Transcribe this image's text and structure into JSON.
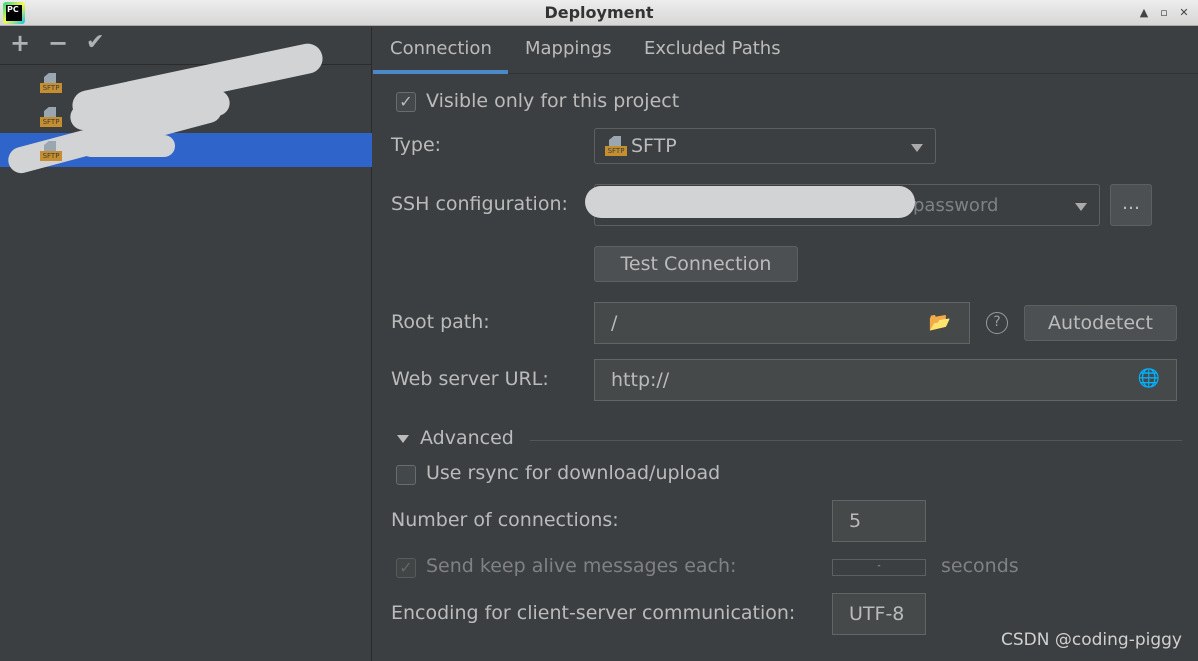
{
  "window": {
    "title": "Deployment",
    "logo_text": "PC"
  },
  "sidebar": {
    "add": "+",
    "remove": "−",
    "apply": "✔",
    "items": [
      {
        "badge": "SFTP",
        "selected": false
      },
      {
        "badge": "SFTP",
        "selected": false
      },
      {
        "badge": "SFTP",
        "selected": true
      }
    ]
  },
  "tabs": [
    {
      "label": "Connection",
      "active": true
    },
    {
      "label": "Mappings"
    },
    {
      "label": "Excluded Paths"
    }
  ],
  "form": {
    "visible_only": {
      "label": "Visible only for this project",
      "checked": true
    },
    "type": {
      "label": "Type:",
      "value": "SFTP",
      "badge": "SFTP"
    },
    "ssh": {
      "label": "SSH configuration:",
      "value_suffix": "password",
      "browse": "..."
    },
    "test_connection": "Test Connection",
    "root_path": {
      "label": "Root path:",
      "value": "/",
      "autodetect": "Autodetect",
      "help": "?"
    },
    "web_url": {
      "label": "Web server URL:",
      "value": "http://"
    },
    "advanced": "Advanced",
    "rsync": {
      "label": "Use rsync for download/upload",
      "checked": false
    },
    "connections": {
      "label": "Number of connections:",
      "value": "5"
    },
    "keepalive": {
      "label": "Send keep alive messages each:",
      "checked": true,
      "disabled": true,
      "value": "-",
      "unit": "seconds"
    },
    "encoding": {
      "label": "Encoding for client-server communication:",
      "value": "UTF-8"
    }
  },
  "watermark": "CSDN @coding-piggy",
  "colors": {
    "background": "#3c3f41",
    "selection": "#2f65ca",
    "tab_underline": "#4a88c7",
    "sftp_badge": "#c58e2f"
  }
}
